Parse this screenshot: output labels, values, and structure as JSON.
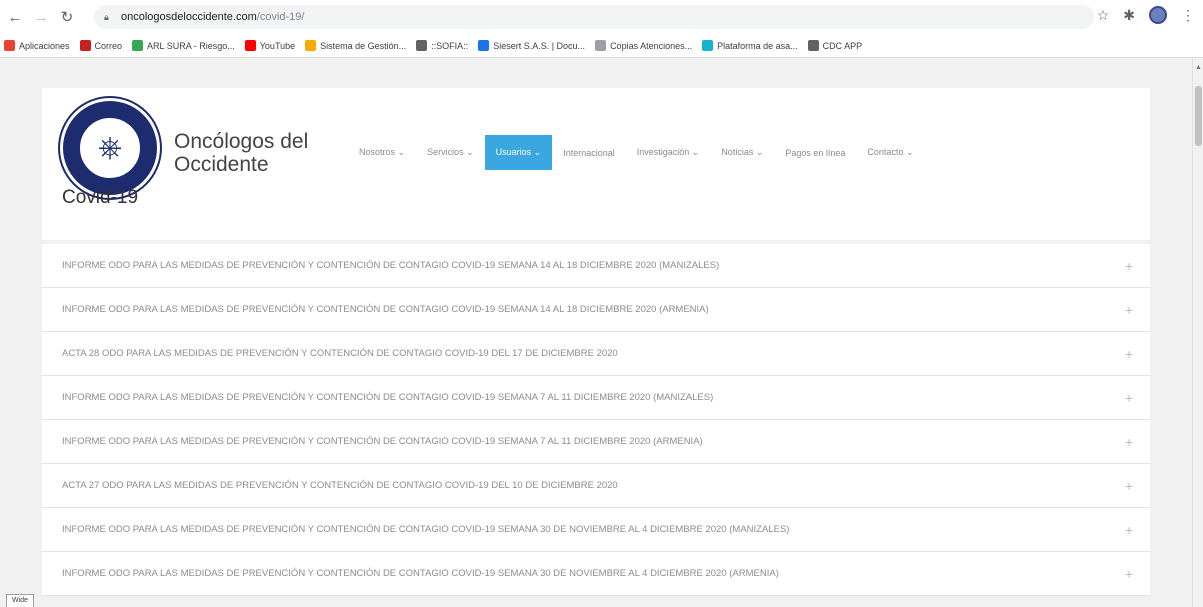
{
  "browser": {
    "url_host": "oncologosdeloccidente.com",
    "url_path": "/covid-19/",
    "bookmarks": [
      {
        "label": "Aplicaciones",
        "color": "#ea4335"
      },
      {
        "label": "Correo",
        "color": "#c5221f"
      },
      {
        "label": "ARL SURA - Riesgo...",
        "color": "#34a853"
      },
      {
        "label": "YouTube",
        "color": "#ff0000"
      },
      {
        "label": "Sistema de Gestión...",
        "color": "#f9ab00"
      },
      {
        "label": "::SOFIA::",
        "color": "#5f6368"
      },
      {
        "label": "Siesert S.A.S. | Docu...",
        "color": "#1a73e8"
      },
      {
        "label": "Copias Atenciones...",
        "color": "#9aa0a6"
      },
      {
        "label": "Plataforma de asa...",
        "color": "#12b5cb"
      },
      {
        "label": "CDC APP",
        "color": "#5f6368"
      }
    ]
  },
  "header": {
    "site_title": "Oncólogos del Occidente",
    "menu": [
      {
        "label": "Nosotros ⌄",
        "active": false
      },
      {
        "label": "Servicios ⌄",
        "active": false
      },
      {
        "label": "Usuarios ⌄",
        "active": true
      },
      {
        "label": "Internacional",
        "active": false
      },
      {
        "label": "Investigación ⌄",
        "active": false
      },
      {
        "label": "Noticias ⌄",
        "active": false
      },
      {
        "label": "Pagos en línea",
        "active": false
      },
      {
        "label": "Contacto ⌄",
        "active": false
      }
    ]
  },
  "main": {
    "title": "Covid-19",
    "items": [
      "INFORME ODO PARA LAS MEDIDAS DE PREVENCIÓN Y CONTENCIÓN DE CONTAGIO COVID-19 SEMANA 14 AL 18 DICIEMBRE 2020 (MANIZALES)",
      "INFORME ODO PARA LAS MEDIDAS DE PREVENCIÓN Y CONTENCIÓN DE CONTAGIO COVID-19 SEMANA 14 AL 18 DICIEMBRE 2020 (ARMENIA)",
      "ACTA 28 ODO PARA LAS MEDIDAS DE PREVENCIÓN Y CONTENCIÓN DE CONTAGIO COVID-19 DEL 17 DE DICIEMBRE 2020",
      "INFORME ODO PARA LAS MEDIDAS DE PREVENCIÓN Y CONTENCIÓN DE CONTAGIO COVID-19 SEMANA 7 AL 11 DICIEMBRE 2020 (MANIZALES)",
      "INFORME ODO PARA LAS MEDIDAS DE PREVENCIÓN Y CONTENCIÓN DE CONTAGIO COVID-19 SEMANA 7 AL 11 DICIEMBRE 2020 (ARMENIA)",
      "ACTA 27 ODO PARA LAS MEDIDAS DE PREVENCIÓN Y CONTENCIÓN DE CONTAGIO COVID-19 DEL 10 DE DICIEMBRE 2020",
      "INFORME ODO PARA LAS MEDIDAS DE PREVENCIÓN Y CONTENCIÓN DE CONTAGIO COVID-19 SEMANA 30 DE NOVIEMBRE AL 4 DICIEMBRE 2020 (MANIZALES)",
      "INFORME ODO PARA LAS MEDIDAS DE PREVENCIÓN Y CONTENCIÓN DE CONTAGIO COVID-19 SEMANA 30 DE NOVIEMBRE AL 4 DICIEMBRE 2020 (ARMENIA)"
    ],
    "expand_glyph": "+"
  },
  "status_bar": {
    "text": "Wide"
  },
  "colors": {
    "accent": "#3aa7e0",
    "brand": "#1c2c6e"
  }
}
